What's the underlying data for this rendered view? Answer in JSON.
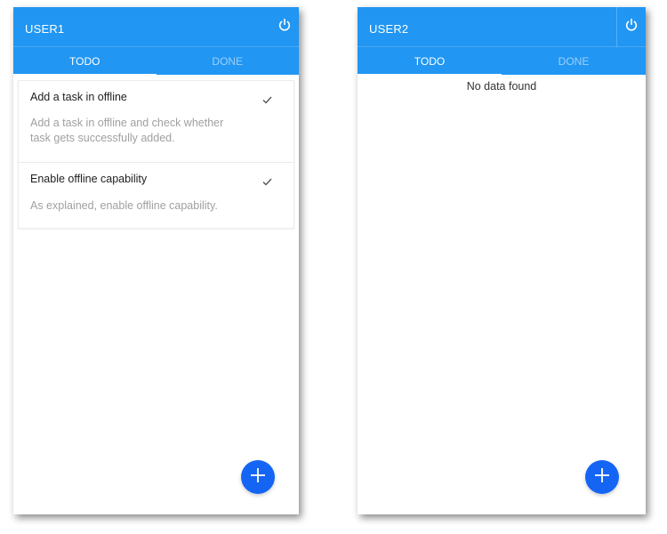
{
  "screens": [
    {
      "user": "USER1",
      "power_icon": "power-icon",
      "tabs": [
        {
          "label": "TODO",
          "active": true
        },
        {
          "label": "DONE",
          "active": false
        }
      ],
      "tasks": [
        {
          "title": "Add a task in offline",
          "description": "Add a task in offline and check whether task gets successfully added.",
          "icon": "check-icon"
        },
        {
          "title": "Enable offline capability",
          "description": "As explained, enable offline capability.",
          "icon": "check-icon"
        }
      ],
      "fab_icon": "plus-icon"
    },
    {
      "user": "USER2",
      "power_icon": "power-icon",
      "tabs": [
        {
          "label": "TODO",
          "active": true
        },
        {
          "label": "DONE",
          "active": false
        }
      ],
      "empty_message": "No data found",
      "fab_icon": "plus-icon"
    }
  ],
  "colors": {
    "appbar": "#2196F3",
    "fab": "#1565F5",
    "muted_text": "#a0a0a0"
  }
}
